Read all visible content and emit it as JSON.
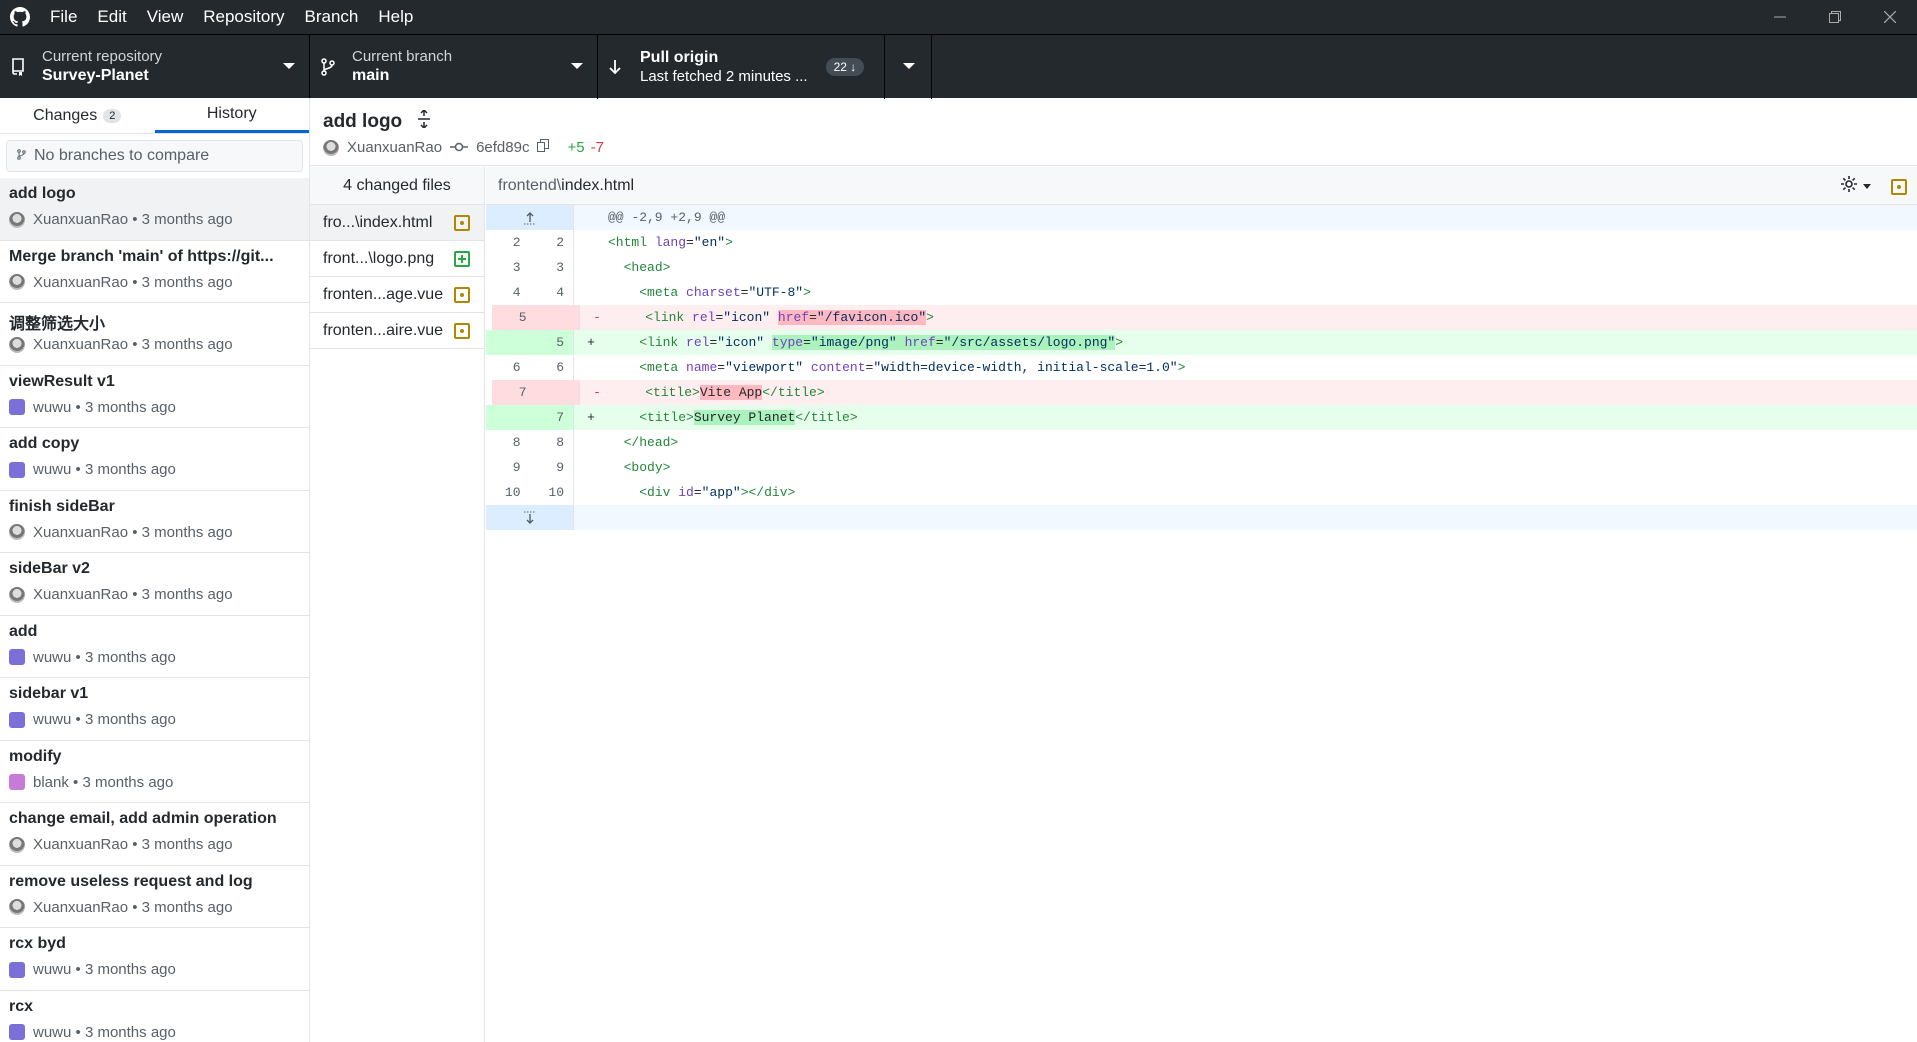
{
  "menu": [
    "File",
    "Edit",
    "View",
    "Repository",
    "Branch",
    "Help"
  ],
  "toolbar": {
    "repo_label": "Current repository",
    "repo_name": "Survey-Planet",
    "branch_label": "Current branch",
    "branch_name": "main",
    "pull_label": "Pull origin",
    "pull_sub": "Last fetched 2 minutes ...",
    "pull_count": "22 ↓"
  },
  "sidebar": {
    "tab_changes": "Changes",
    "tab_changes_count": "2",
    "tab_history": "History",
    "compare_placeholder": "No branches to compare",
    "commits": [
      {
        "msg": "add logo",
        "author": "XuanxuanRao",
        "time": "3 months ago",
        "avatar": "xr"
      },
      {
        "msg": "Merge branch 'main' of https://git...",
        "author": "XuanxuanRao",
        "time": "3 months ago",
        "avatar": "xr"
      },
      {
        "msg": "调整筛选大小",
        "author": "XuanxuanRao",
        "time": "3 months ago",
        "avatar": "xr"
      },
      {
        "msg": "viewResult v1",
        "author": "wuwu",
        "time": "3 months ago",
        "avatar": "ww"
      },
      {
        "msg": "add copy",
        "author": "wuwu",
        "time": "3 months ago",
        "avatar": "ww"
      },
      {
        "msg": "finish sideBar",
        "author": "XuanxuanRao",
        "time": "3 months ago",
        "avatar": "xr"
      },
      {
        "msg": "sideBar v2",
        "author": "XuanxuanRao",
        "time": "3 months ago",
        "avatar": "xr"
      },
      {
        "msg": "add",
        "author": "wuwu",
        "time": "3 months ago",
        "avatar": "ww"
      },
      {
        "msg": "sidebar v1",
        "author": "wuwu",
        "time": "3 months ago",
        "avatar": "ww"
      },
      {
        "msg": "modify",
        "author": "blank",
        "time": "3 months ago",
        "avatar": "bk"
      },
      {
        "msg": "change email, add admin operation",
        "author": "XuanxuanRao",
        "time": "3 months ago",
        "avatar": "xr"
      },
      {
        "msg": "remove useless request and log",
        "author": "XuanxuanRao",
        "time": "3 months ago",
        "avatar": "xr"
      },
      {
        "msg": "rcx byd",
        "author": "wuwu",
        "time": "3 months ago",
        "avatar": "ww"
      },
      {
        "msg": "rcx",
        "author": "wuwu",
        "time": "3 months ago",
        "avatar": "ww"
      }
    ]
  },
  "commit": {
    "title": "add logo",
    "author": "XuanxuanRao",
    "sha": "6efd89c",
    "additions": "+5",
    "deletions": "-7"
  },
  "files": {
    "header": "4 changed files",
    "items": [
      {
        "name": "fro...\\index.html",
        "status": "mod"
      },
      {
        "name": "front...\\logo.png",
        "status": "new"
      },
      {
        "name": "fronten...age.vue",
        "status": "mod"
      },
      {
        "name": "fronten...aire.vue",
        "status": "mod"
      }
    ]
  },
  "diff": {
    "dir": "frontend\\",
    "file": "index.html",
    "hunk": "@@ -2,9 +2,9 @@"
  }
}
